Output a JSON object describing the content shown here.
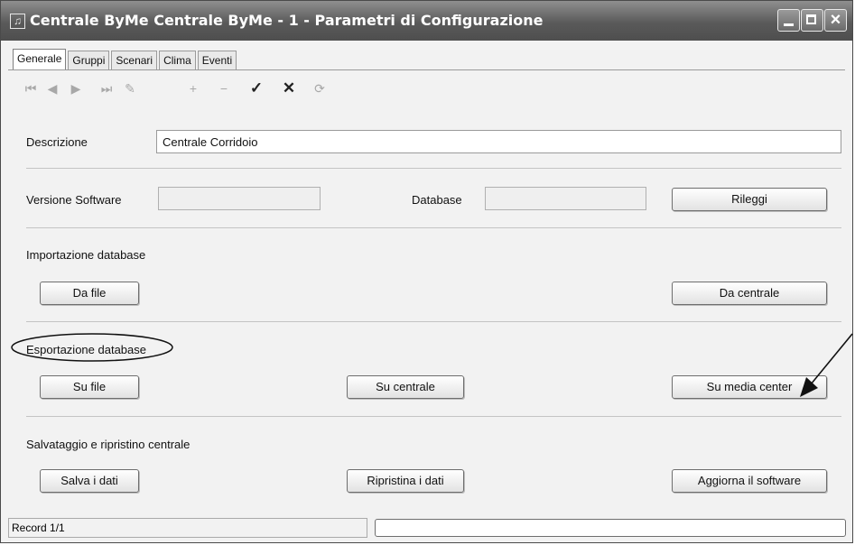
{
  "window": {
    "title": "Centrale ByMe Centrale ByMe - 1 - Parametri di Configurazione"
  },
  "tabs": [
    "Generale",
    "Gruppi",
    "Scenari",
    "Clima",
    "Eventi"
  ],
  "toolbar": {
    "first": "⏮",
    "prev": "◀",
    "next": "▶",
    "last": "⏭",
    "edit": "✎",
    "add": "+",
    "remove": "−",
    "confirm": "✓",
    "cancel": "✕",
    "refresh": "⟳"
  },
  "descrizione": {
    "label": "Descrizione",
    "value": "Centrale Corridoio"
  },
  "versione": {
    "label": "Versione Software",
    "value": "",
    "database_label": "Database",
    "database_value": "",
    "rileggi": "Rileggi"
  },
  "importazione": {
    "title": "Importazione database",
    "da_file": "Da file",
    "da_centrale": "Da centrale"
  },
  "esportazione": {
    "title": "Esportazione database",
    "su_file": "Su file",
    "su_centrale": "Su centrale",
    "su_media_center": "Su media center"
  },
  "salvataggio": {
    "title": "Salvataggio e ripristino centrale",
    "salva": "Salva i dati",
    "ripristina": "Ripristina i dati",
    "aggiorna": "Aggiorna il software"
  },
  "status": {
    "record": "Record 1/1"
  }
}
